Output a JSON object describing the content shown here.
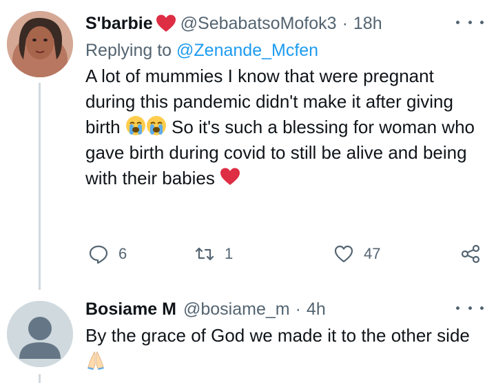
{
  "tweets": [
    {
      "display_name": "S'barbie",
      "handle": "@SebabatsoMofok3",
      "separator": "·",
      "time": "18h",
      "replying_prefix": "Replying to",
      "replying_to": "@Zenande_Mcfen",
      "text_part1": "A lot of mummies I know that were pregnant during this pandemic didn't make it after giving birth",
      "text_part2": "So it's such a blessing for woman who gave birth during covid to still be alive and being with their babies",
      "emojis": [
        "loudly-crying-face",
        "loudly-crying-face",
        "red-heart"
      ],
      "actions": {
        "replies": "6",
        "retweets": "1",
        "likes": "47"
      },
      "icons": {
        "reply": "speech-bubble-icon",
        "retweet": "retweet-icon",
        "like": "heart-outline-icon",
        "share": "share-icon",
        "more": "more-dots-icon"
      }
    },
    {
      "display_name": "Bosiame M",
      "handle": "@bosiame_m",
      "separator": "·",
      "time": "4h",
      "text": "By the grace of God we made it to the other side",
      "emojis": [
        "folded-hands"
      ],
      "icons": {
        "more": "more-dots-icon",
        "avatar": "default-avatar-icon"
      }
    }
  ],
  "colors": {
    "secondary_text": "#536471",
    "link": "#1d9bf0",
    "thread_line": "#cfd9de",
    "heart_red": "#e0245e"
  }
}
